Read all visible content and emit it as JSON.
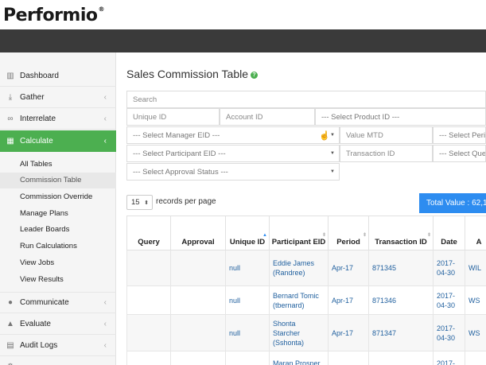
{
  "brand": {
    "name": "Performio",
    "reg": "®"
  },
  "sidebar": {
    "items": [
      {
        "label": "Dashboard",
        "icon": "bar-chart-icon",
        "chevron": false,
        "active": false
      },
      {
        "label": "Gather",
        "icon": "download-icon",
        "chevron": true,
        "active": false
      },
      {
        "label": "Interrelate",
        "icon": "link-icon",
        "chevron": true,
        "active": false
      },
      {
        "label": "Calculate",
        "icon": "table-icon",
        "chevron": true,
        "active": true
      },
      {
        "label": "Communicate",
        "icon": "chat-icon",
        "chevron": true,
        "active": false
      },
      {
        "label": "Evaluate",
        "icon": "thumbs-up-icon",
        "chevron": true,
        "active": false
      },
      {
        "label": "Audit Logs",
        "icon": "book-icon",
        "chevron": true,
        "active": false
      }
    ],
    "calculate_sub": [
      "All Tables",
      "Commission Table",
      "Commission Override",
      "Manage Plans",
      "Leader Boards",
      "Run Calculations",
      "View Jobs",
      "View Results"
    ],
    "selected_sub": "Commission Table"
  },
  "page": {
    "title": "Sales Commission Table",
    "help_icon": "?"
  },
  "filters": {
    "search": "Search",
    "unique_id": "Unique ID",
    "account_id": "Account ID",
    "product_id": "--- Select Product ID ---",
    "manager_eid": "--- Select Manager EID ---",
    "value_mtd": "Value MTD",
    "period": "--- Select Perio",
    "participant_eid": "--- Select Participant EID ---",
    "transaction_id": "Transaction ID",
    "query": "--- Select Quer",
    "approval_status": "--- Select Approval Status ---"
  },
  "table_controls": {
    "page_length": "15",
    "records_label": "records per page",
    "total_value": "Total Value : 62,1"
  },
  "table": {
    "headers": [
      "Query",
      "Approval",
      "Unique ID",
      "Participant EID",
      "Period",
      "Transaction ID",
      "Date",
      "A"
    ],
    "rows": [
      {
        "query": "",
        "approval": "",
        "unique_id": "null",
        "participant": "Eddie James (Randree)",
        "period": "Apr-17",
        "transaction_id": "871345",
        "date": "2017-04-30",
        "extra": "WIL"
      },
      {
        "query": "",
        "approval": "",
        "unique_id": "null",
        "participant": "Bernard Tomic (tbernard)",
        "period": "Apr-17",
        "transaction_id": "871346",
        "date": "2017-04-30",
        "extra": "WS"
      },
      {
        "query": "",
        "approval": "",
        "unique_id": "null",
        "participant": "Shonta Starcher (Sshonta)",
        "period": "Apr-17",
        "transaction_id": "871347",
        "date": "2017-04-30",
        "extra": "WS"
      },
      {
        "query": "",
        "approval": "",
        "unique_id": "",
        "participant": "Maran Prosper",
        "period": "",
        "transaction_id": "",
        "date": "2017-",
        "extra": ""
      }
    ]
  },
  "colors": {
    "accent_green": "#4caf50",
    "total_blue": "#2d8cf0",
    "link_blue": "#1f5f9e",
    "dark_bar": "#3a3a3a"
  }
}
